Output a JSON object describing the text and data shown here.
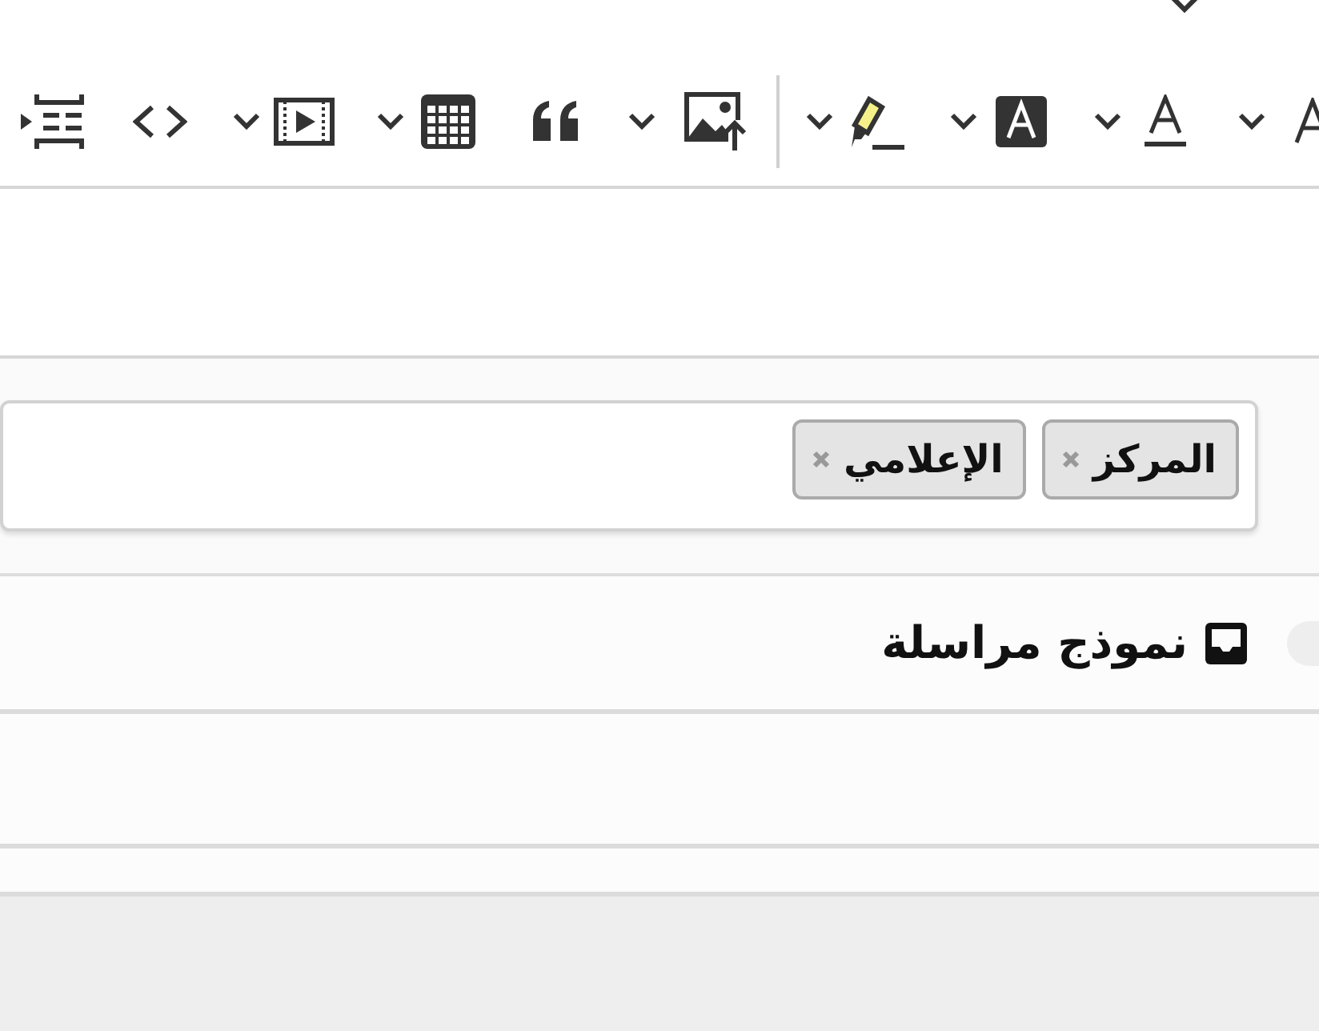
{
  "toolbar": {
    "items": [
      {
        "kind": "indent"
      },
      {
        "kind": "code"
      },
      {
        "kind": "chevron"
      },
      {
        "kind": "video"
      },
      {
        "kind": "chevron"
      },
      {
        "kind": "table"
      },
      {
        "kind": "quote"
      },
      {
        "kind": "chevron"
      },
      {
        "kind": "image"
      },
      {
        "kind": "separator"
      },
      {
        "kind": "chevron"
      },
      {
        "kind": "highlight"
      },
      {
        "kind": "chevron"
      },
      {
        "kind": "letter-bg"
      },
      {
        "kind": "chevron"
      },
      {
        "kind": "letter-underline"
      },
      {
        "kind": "chevron"
      },
      {
        "kind": "letter"
      }
    ]
  },
  "tags": [
    {
      "label": "المركز"
    },
    {
      "label": "الإعلامي"
    }
  ],
  "section": {
    "title": "نموذج مراسلة",
    "toggle": {
      "on": false
    }
  }
}
